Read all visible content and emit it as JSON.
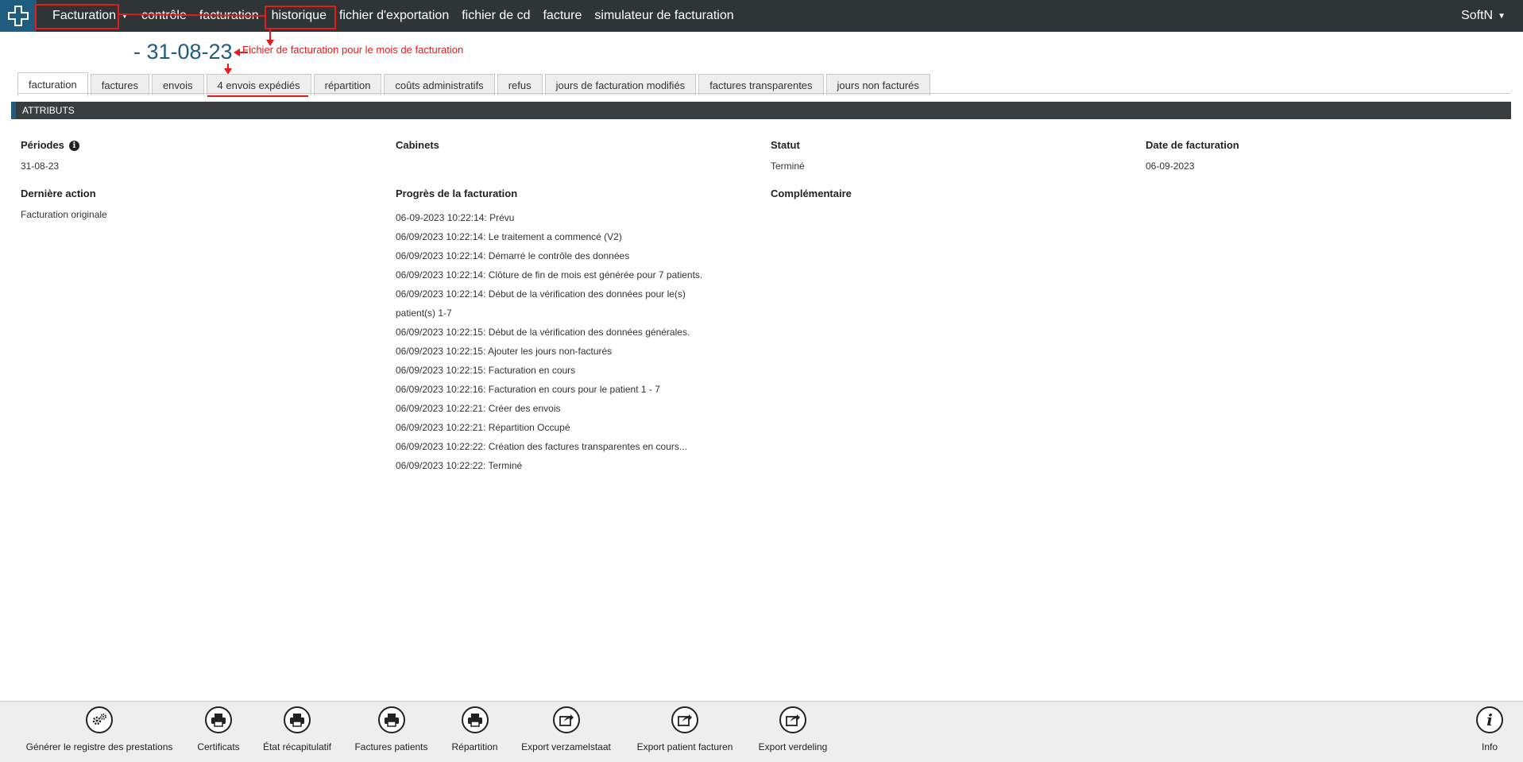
{
  "navbar": {
    "logo_icon": "cross-logo-icon",
    "items": [
      {
        "label": "Facturation"
      },
      {
        "label": "contrôle"
      },
      {
        "label": "facturation"
      },
      {
        "label": "historique"
      },
      {
        "label": "fichier d'exportation"
      },
      {
        "label": "fichier de cd"
      },
      {
        "label": "facture"
      },
      {
        "label": "simulateur de facturation"
      }
    ],
    "user": "SoftN"
  },
  "annotation": {
    "text": "Fichier de facturation pour le mois de facturation",
    "color": "#e31b1b"
  },
  "page": {
    "title": "- 31-08-23"
  },
  "tabs": [
    {
      "label": "facturation"
    },
    {
      "label": "factures"
    },
    {
      "label": "envois"
    },
    {
      "label": "4 envois expédiés"
    },
    {
      "label": "répartition"
    },
    {
      "label": "coûts administratifs"
    },
    {
      "label": "refus"
    },
    {
      "label": "jours de facturation modifiés"
    },
    {
      "label": "factures transparentes"
    },
    {
      "label": "jours non facturés"
    }
  ],
  "section": {
    "title": "ATTRIBUTS"
  },
  "attributes": {
    "periodes_label": "Périodes",
    "periodes_value": "31-08-23",
    "cabinets_label": "Cabinets",
    "statut_label": "Statut",
    "statut_value": "Terminé",
    "date_label": "Date de facturation",
    "date_value": "06-09-2023",
    "derniere_label": "Dernière action",
    "derniere_value": "Facturation originale",
    "progres_label": "Progrès de la facturation",
    "complementaire_label": "Complémentaire"
  },
  "progress": [
    "06-09-2023 10:22:14: Prévu",
    "06/09/2023 10:22:14: Le traitement a commencé (V2)",
    "06/09/2023 10:22:14: Démarré le contrôle des données",
    "06/09/2023 10:22:14: Clôture de fin de mois est générée pour  7 patients.",
    "06/09/2023 10:22:14: Début de la vérification des données pour le(s)",
    "patient(s)  1-7",
    "06/09/2023 10:22:15: Début de la vérification des données générales.",
    "06/09/2023 10:22:15: Ajouter les jours non-facturés",
    "06/09/2023 10:22:15: Facturation en cours",
    "06/09/2023 10:22:16: Facturation en cours pour le patient 1 - 7",
    "06/09/2023 10:22:21: Créer des envois",
    "06/09/2023 10:22:21: Répartition Occupé",
    "06/09/2023 10:22:22: Création des factures transparentes en cours...",
    "06/09/2023 10:22:22: Terminé"
  ],
  "toolbar": [
    {
      "label": "Générer le registre des prestations",
      "icon": "gears-icon"
    },
    {
      "label": "Certificats",
      "icon": "printer-icon"
    },
    {
      "label": "État récapitulatif",
      "icon": "printer-icon"
    },
    {
      "label": "Factures patients",
      "icon": "printer-icon"
    },
    {
      "label": "Répartition",
      "icon": "printer-icon"
    },
    {
      "label": "Export verzamelstaat",
      "icon": "export-icon"
    },
    {
      "label": "Export patient facturen",
      "icon": "export-icon"
    },
    {
      "label": "Export verdeling",
      "icon": "export-icon"
    },
    {
      "label": "Info",
      "icon": "info-icon"
    }
  ]
}
